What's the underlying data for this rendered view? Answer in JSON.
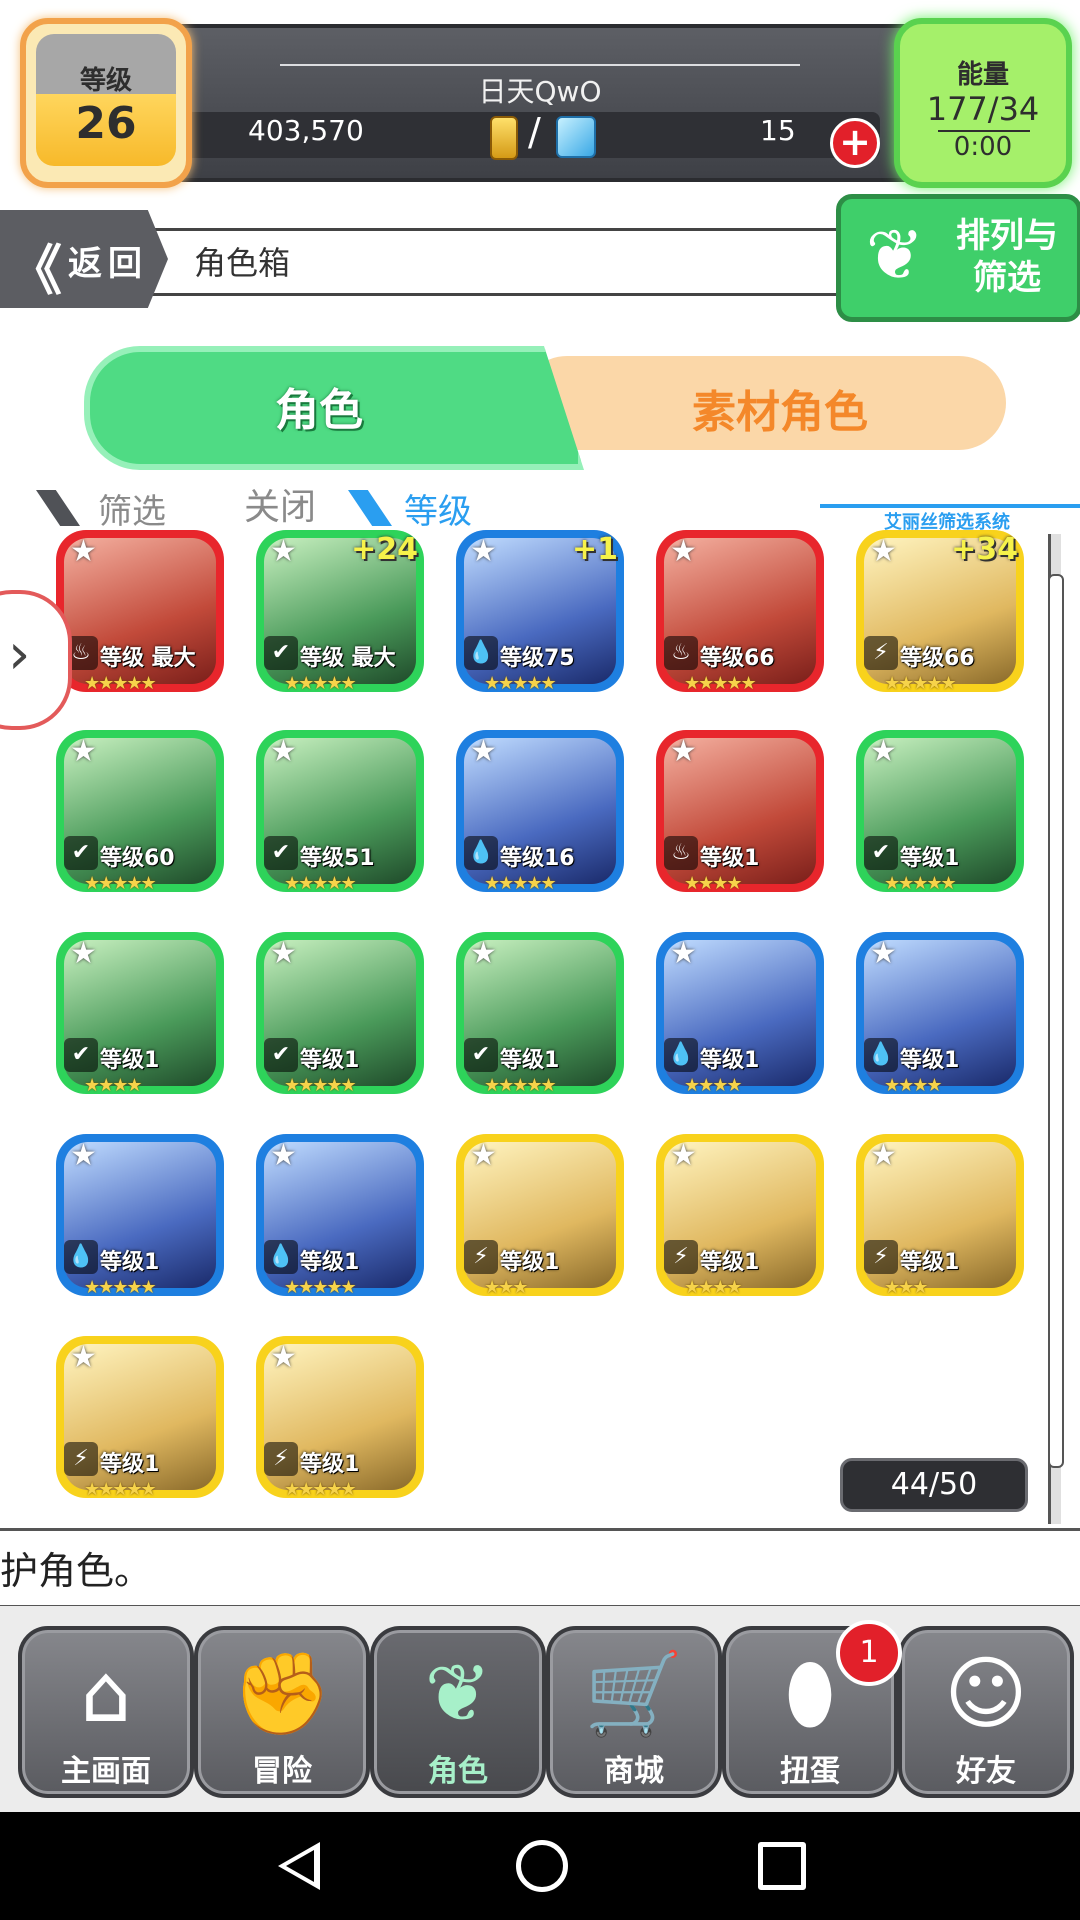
{
  "header": {
    "level_label": "等级",
    "level_value": "26",
    "player_name": "日天QwO",
    "gold": "403,570",
    "slash": "/",
    "gem_count": "15",
    "plus": "+",
    "energy_label": "能量",
    "energy_value": "177/34",
    "energy_timer": "0:00"
  },
  "nav_bar": {
    "back_chevron": "《",
    "back_label": "返回",
    "page_title": "角色箱",
    "sort_label": "排列与筛选"
  },
  "tabs": {
    "characters": "角色",
    "material": "素材角色",
    "active": "characters"
  },
  "filter_bar": {
    "filter": "筛选",
    "close": "关闭",
    "sort_by": "等级",
    "system": "艾丽丝筛选系统"
  },
  "characters": [
    {
      "frame": "red",
      "element": "♨",
      "level": "等级 最大",
      "plus": "",
      "stars": "★★★★★"
    },
    {
      "frame": "green",
      "element": "✔",
      "level": "等级 最大",
      "plus": "+24",
      "stars": "★★★★★"
    },
    {
      "frame": "blue",
      "element": "💧",
      "level": "等级75",
      "plus": "+1",
      "stars": "★★★★★"
    },
    {
      "frame": "red",
      "element": "♨",
      "level": "等级66",
      "plus": "",
      "stars": "★★★★★"
    },
    {
      "frame": "yellow",
      "element": "⚡",
      "level": "等级66",
      "plus": "+34",
      "stars": "★★★★★"
    },
    {
      "frame": "green",
      "element": "✔",
      "level": "等级60",
      "plus": "",
      "stars": "★★★★★"
    },
    {
      "frame": "green",
      "element": "✔",
      "level": "等级51",
      "plus": "",
      "stars": "★★★★★"
    },
    {
      "frame": "blue",
      "element": "💧",
      "level": "等级16",
      "plus": "",
      "stars": "★★★★★"
    },
    {
      "frame": "red",
      "element": "♨",
      "level": "等级1",
      "plus": "",
      "stars": "★★★★"
    },
    {
      "frame": "green",
      "element": "✔",
      "level": "等级1",
      "plus": "",
      "stars": "★★★★★"
    },
    {
      "frame": "green",
      "element": "✔",
      "level": "等级1",
      "plus": "",
      "stars": "★★★★"
    },
    {
      "frame": "green",
      "element": "✔",
      "level": "等级1",
      "plus": "",
      "stars": "★★★★★"
    },
    {
      "frame": "green",
      "element": "✔",
      "level": "等级1",
      "plus": "",
      "stars": "★★★★★"
    },
    {
      "frame": "blue",
      "element": "💧",
      "level": "等级1",
      "plus": "",
      "stars": "★★★★"
    },
    {
      "frame": "blue",
      "element": "💧",
      "level": "等级1",
      "plus": "",
      "stars": "★★★★"
    },
    {
      "frame": "blue",
      "element": "💧",
      "level": "等级1",
      "plus": "",
      "stars": "★★★★★"
    },
    {
      "frame": "blue",
      "element": "💧",
      "level": "等级1",
      "plus": "",
      "stars": "★★★★★"
    },
    {
      "frame": "yellow",
      "element": "⚡",
      "level": "等级1",
      "plus": "",
      "stars": "★★★"
    },
    {
      "frame": "yellow",
      "element": "⚡",
      "level": "等级1",
      "plus": "",
      "stars": "★★★★"
    },
    {
      "frame": "yellow",
      "element": "⚡",
      "level": "等级1",
      "plus": "",
      "stars": "★★★"
    },
    {
      "frame": "yellow",
      "element": "⚡",
      "level": "等级1",
      "plus": "",
      "stars": "★★★★★"
    },
    {
      "frame": "yellow",
      "element": "⚡",
      "level": "等级1",
      "plus": "",
      "stars": "★★★★★"
    }
  ],
  "box_count": "44/50",
  "message": "护角色。",
  "bottom_nav": [
    {
      "icon": "house-icon",
      "glyph": "⌂",
      "label": "主画面",
      "active": false
    },
    {
      "icon": "handshake-icon",
      "glyph": "✊",
      "label": "冒险",
      "active": false
    },
    {
      "icon": "rabbit-icon",
      "glyph": "❦",
      "label": "角色",
      "active": true
    },
    {
      "icon": "cart-icon",
      "glyph": "🛒",
      "label": "商城",
      "active": false
    },
    {
      "icon": "egg-icon",
      "glyph": "⬮",
      "label": "扭蛋",
      "active": false
    },
    {
      "icon": "friends-icon",
      "glyph": "☺",
      "label": "好友",
      "active": false
    }
  ],
  "gacha_badge": "1",
  "colors": {
    "green_accent": "#2ed35a",
    "orange_accent": "#f4882a",
    "blue_accent": "#2a9ef0",
    "red_badge": "#e2202a"
  }
}
